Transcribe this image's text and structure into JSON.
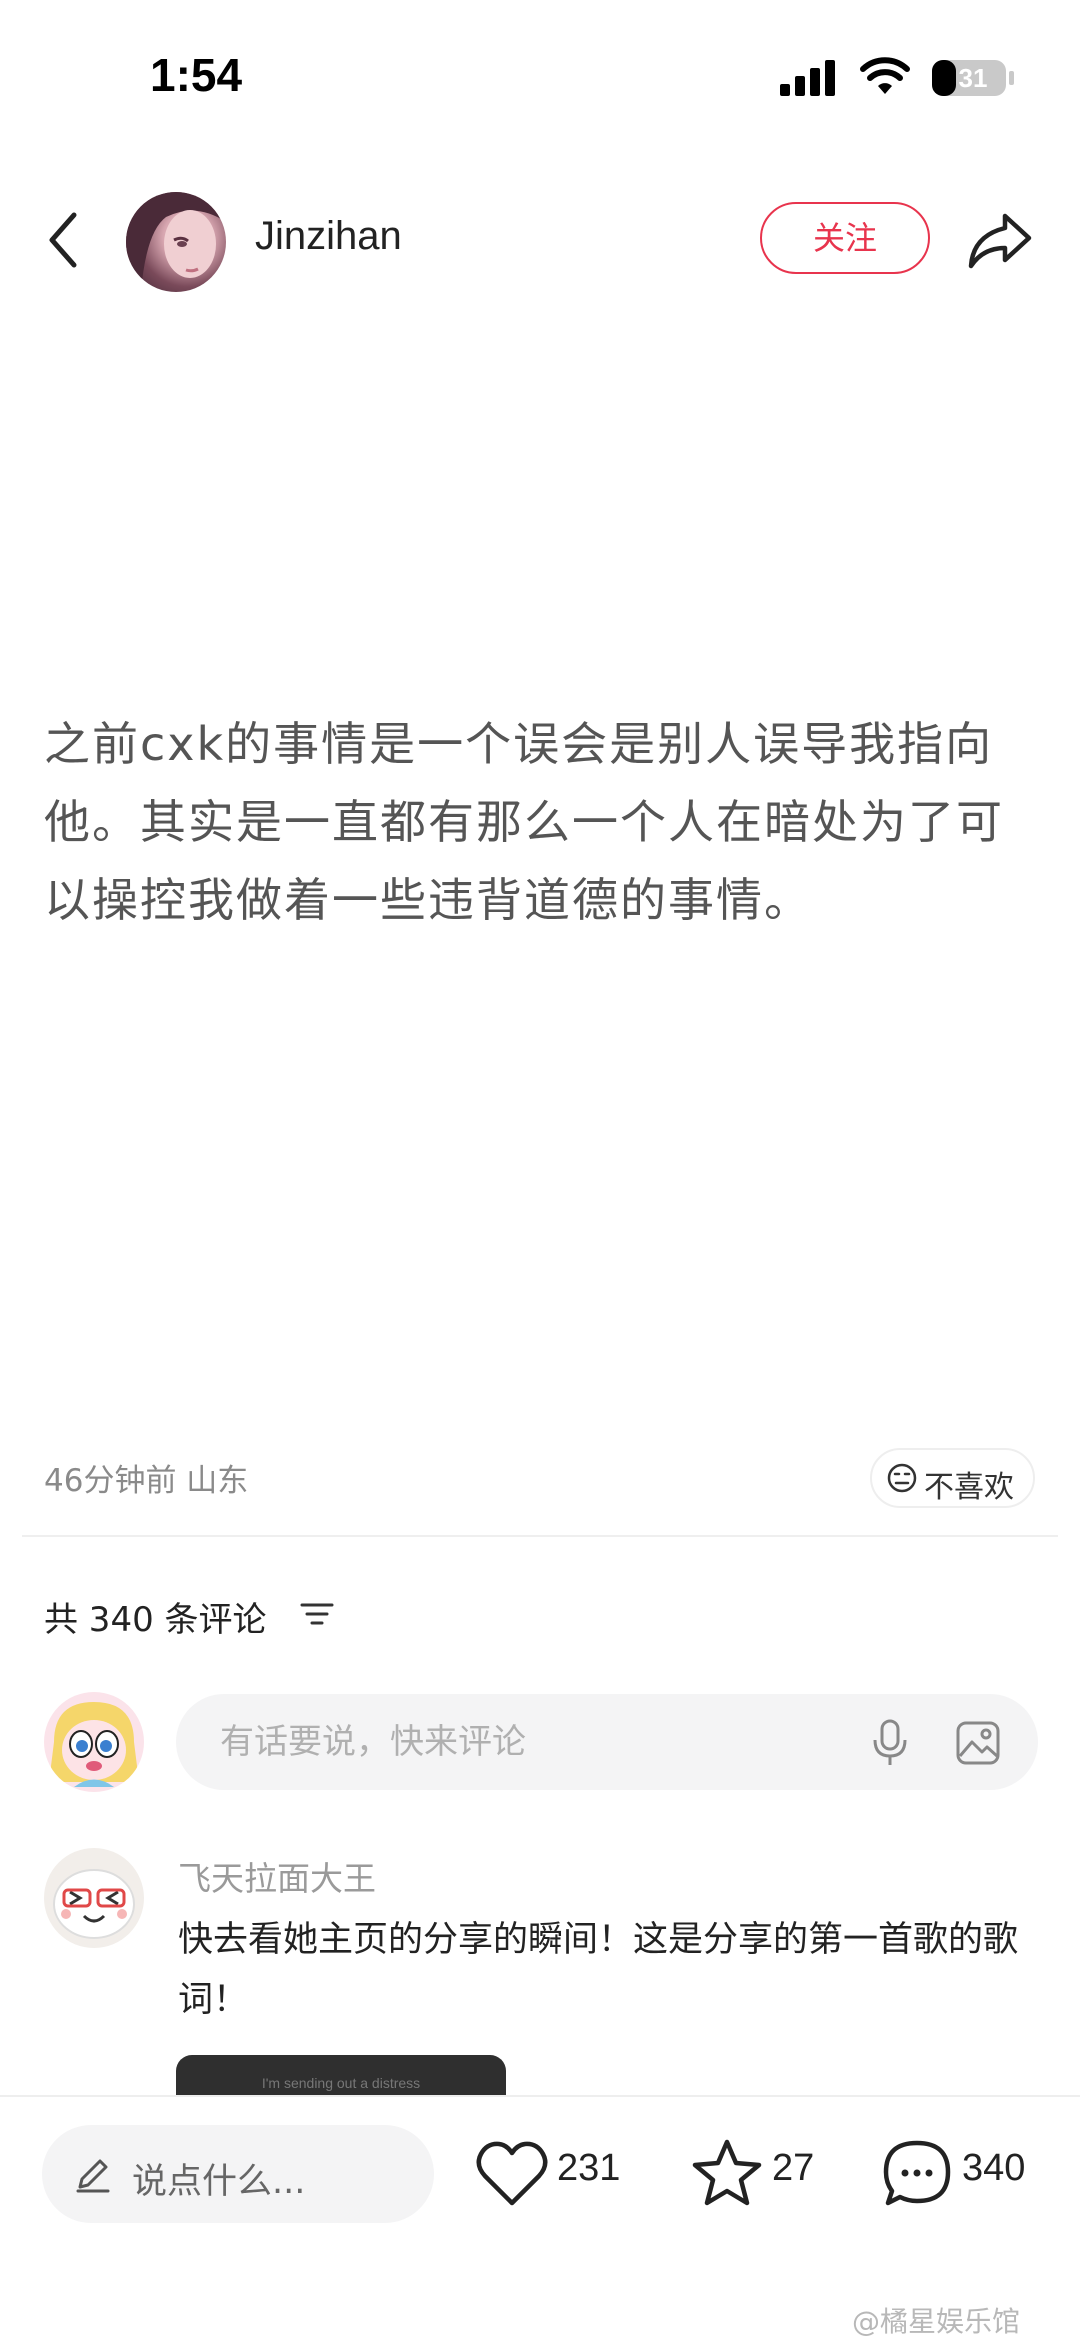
{
  "status_bar": {
    "time": "1:54",
    "battery": "31"
  },
  "header": {
    "author_name": "Jinzihan",
    "follow_label": "关注"
  },
  "post": {
    "text": "之前cxk的事情是一个误会是别人误导我指向他。其实是一直都有那么一个人在暗处为了可以操控我做着一些违背道德的事情。",
    "meta": "46分钟前 山东",
    "dislike_label": "不喜欢"
  },
  "comments": {
    "header": "共 340 条评论",
    "input_placeholder": "有话要说，快来评论",
    "items": [
      {
        "name": "飞天拉面大王",
        "text": "快去看她主页的分享的瞬间！这是分享的第一首歌的歌词！",
        "image_caption": "I'm sending out a distress"
      }
    ]
  },
  "bottom_bar": {
    "say_label": "说点什么...",
    "likes": "231",
    "collects": "27",
    "comments": "340"
  },
  "watermark": "@橘星娱乐馆",
  "colors": {
    "accent": "#e8344d",
    "muted": "#8a8a8a",
    "input_bg": "#f4f4f5"
  }
}
